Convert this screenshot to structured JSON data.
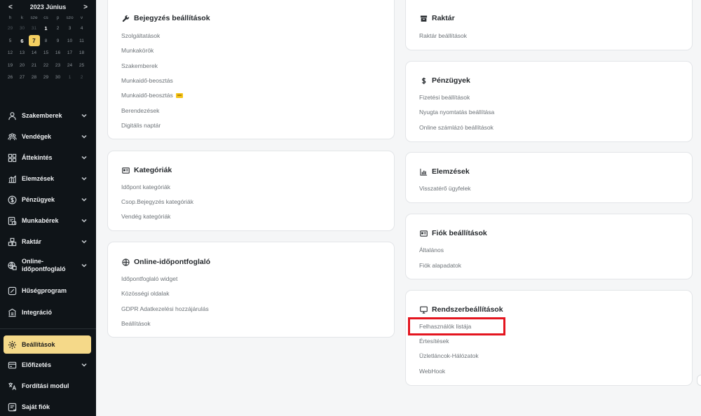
{
  "calendar": {
    "prev": "<",
    "next": ">",
    "title": "2023 Június",
    "weekdays": [
      "h",
      "k",
      "sze",
      "cs",
      "p",
      "szo",
      "v"
    ],
    "weeks": [
      [
        "29",
        "30",
        "31",
        "1",
        "2",
        "3",
        "4"
      ],
      [
        "5",
        "6",
        "7",
        "8",
        "9",
        "10",
        "11"
      ],
      [
        "12",
        "13",
        "14",
        "15",
        "16",
        "17",
        "18"
      ],
      [
        "19",
        "20",
        "21",
        "22",
        "23",
        "24",
        "25"
      ],
      [
        "26",
        "27",
        "28",
        "29",
        "30",
        "1",
        "2"
      ]
    ],
    "today": "6",
    "selected": "7",
    "accent": "#f5d061"
  },
  "sidebar": {
    "items": [
      {
        "label": "Szakemberek",
        "icon": "user-icon",
        "chevron": true
      },
      {
        "label": "Vendégek",
        "icon": "users-icon",
        "chevron": true
      },
      {
        "label": "Áttekintés",
        "icon": "grid-icon",
        "chevron": true
      },
      {
        "label": "Elemzések",
        "icon": "chart-icon",
        "chevron": true
      },
      {
        "label": "Pénzügyek",
        "icon": "dollar-icon",
        "chevron": true
      },
      {
        "label": "Munkabérek",
        "icon": "payroll-icon",
        "chevron": true
      },
      {
        "label": "Raktár",
        "icon": "warehouse-icon",
        "chevron": true
      },
      {
        "label": "Online-időpontfoglaló",
        "label_line1": "Online-",
        "label_line2": "időpontfoglaló",
        "icon": "globe-calendar-icon",
        "chevron": true
      },
      {
        "label": "Hűségprogram",
        "icon": "loyalty-icon",
        "chevron": false
      },
      {
        "label": "Integráció",
        "icon": "integration-icon",
        "chevron": false
      },
      {
        "label": "Beállítások",
        "icon": "gear-icon",
        "chevron": false,
        "active": true
      },
      {
        "label": "Előfizetés",
        "icon": "subscription-icon",
        "chevron": true
      },
      {
        "label": "Fordítási modul",
        "icon": "translate-icon",
        "chevron": false
      },
      {
        "label": "Saját fiók",
        "icon": "account-icon",
        "chevron": false
      }
    ],
    "active_color": "#f5d989"
  },
  "cards": {
    "bejegyzes": {
      "title": "Bejegyzés beállítások",
      "icon": "wrench-icon",
      "links": [
        "Szolgáltatások",
        "Munkakörök",
        "Szakemberek",
        "Munkaidő-beosztás",
        "Munkaidő-beosztás",
        "Berendezések",
        "Digitális naptár"
      ],
      "premium_badge_on": 4
    },
    "kategoriak": {
      "title": "Kategóriák",
      "icon": "id-card-icon",
      "links": [
        "Időpont kategóriák",
        "Csop.Bejegyzés kategóriák",
        "Vendég kategóriák"
      ]
    },
    "online": {
      "title": "Online-időpontfoglaló",
      "icon": "globe-icon",
      "links": [
        "Időpontfoglaló widget",
        "Közösségi oldalak",
        "GDPR Adatkezelési hozzájárulás",
        "Beállítások"
      ]
    },
    "raktar": {
      "title": "Raktár",
      "icon": "box-icon",
      "links": [
        "Raktár beállítások"
      ]
    },
    "penzugyek": {
      "title": "Pénzügyek",
      "icon": "dollar-sign-icon",
      "links": [
        "Fizetési beállítások",
        "Nyugta nyomtatás beállítása",
        "Online számlázó beállítások"
      ]
    },
    "elemzesek": {
      "title": "Elemzések",
      "icon": "bar-chart-icon",
      "links": [
        "Visszatérő ügyfelek"
      ]
    },
    "fiok": {
      "title": "Fiók beállítások",
      "icon": "id-card-icon",
      "links": [
        "Általános",
        "Fiók alapadatok"
      ]
    },
    "rendszer": {
      "title": "Rendszerbeállítások",
      "icon": "monitor-icon",
      "links": [
        "Felhasználók listája",
        "Értesítések",
        "Üzletláncok-Hálózatok",
        "WebHook"
      ],
      "highlighted_link": 0,
      "highlight_color": "#e4151f"
    }
  }
}
